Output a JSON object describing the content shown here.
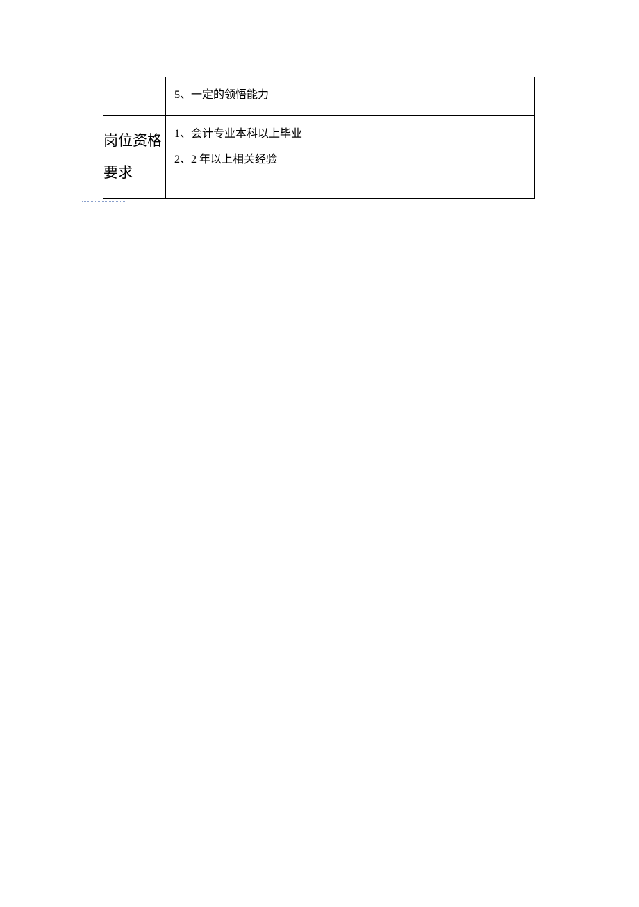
{
  "table": {
    "rows": [
      {
        "label": "",
        "content": [
          "5、一定的领悟能力"
        ]
      },
      {
        "label": "岗位资格要求",
        "content": [
          "1、会计专业本科以上毕业",
          "2、2 年以上相关经验"
        ]
      }
    ]
  }
}
